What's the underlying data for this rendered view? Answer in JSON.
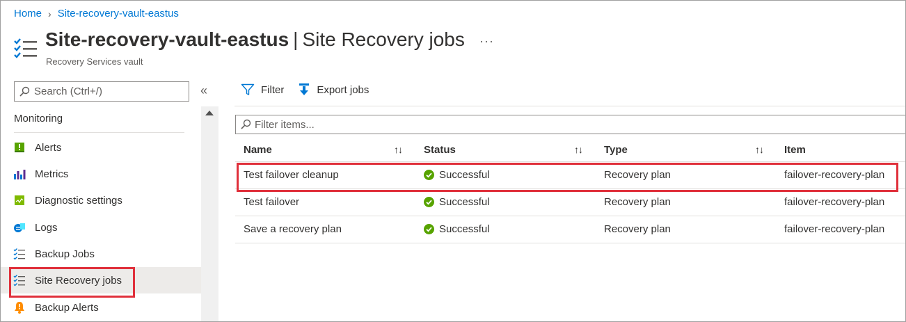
{
  "breadcrumb": {
    "home": "Home",
    "current": "Site-recovery-vault-eastus"
  },
  "header": {
    "resource_name": "Site-recovery-vault-eastus",
    "divider": "|",
    "blade_title": "Site Recovery jobs",
    "more": "···",
    "subtitle": "Recovery Services vault"
  },
  "sidebar": {
    "search_placeholder": "Search (Ctrl+/)",
    "collapse": "«",
    "section": "Monitoring",
    "items": [
      {
        "label": "Alerts",
        "icon": "alerts-icon"
      },
      {
        "label": "Metrics",
        "icon": "metrics-icon"
      },
      {
        "label": "Diagnostic settings",
        "icon": "diagnostic-settings-icon"
      },
      {
        "label": "Logs",
        "icon": "logs-icon"
      },
      {
        "label": "Backup Jobs",
        "icon": "backup-jobs-icon"
      },
      {
        "label": "Site Recovery jobs",
        "icon": "site-recovery-jobs-icon",
        "selected": true
      },
      {
        "label": "Backup Alerts",
        "icon": "backup-alerts-icon"
      }
    ]
  },
  "toolbar": {
    "filter": "Filter",
    "export": "Export jobs"
  },
  "filter_placeholder": "Filter items...",
  "table": {
    "columns": [
      "Name",
      "Status",
      "Type",
      "Item"
    ],
    "sort_glyph": "↑↓",
    "rows": [
      {
        "name": "Test failover cleanup",
        "status": "Successful",
        "type": "Recovery plan",
        "item": "failover-recovery-plan",
        "highlighted": true
      },
      {
        "name": "Test failover",
        "status": "Successful",
        "type": "Recovery plan",
        "item": "failover-recovery-plan"
      },
      {
        "name": "Save a recovery plan",
        "status": "Successful",
        "type": "Recovery plan",
        "item": "failover-recovery-plan"
      }
    ]
  },
  "colors": {
    "accent": "#0078d4",
    "success": "#57a300",
    "highlight": "#e0303b",
    "selected_bg": "#edebe9"
  }
}
